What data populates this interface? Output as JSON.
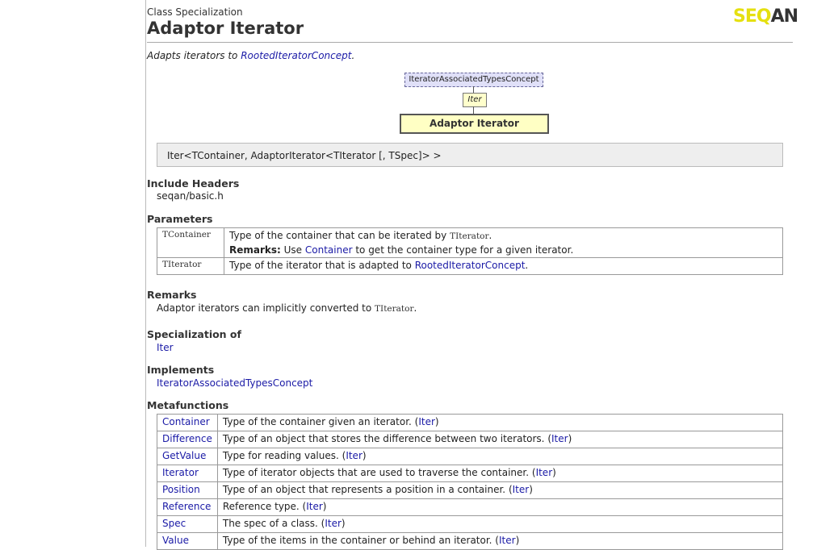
{
  "header": {
    "kind": "Class Specialization",
    "title": "Adaptor Iterator",
    "logo": "SEQAN"
  },
  "summary": {
    "prefix": "Adapts iterators to ",
    "link": "RootedIteratorConcept",
    "suffix": "."
  },
  "diagram": {
    "concept": "IteratorAssociatedTypesConcept",
    "parent": "Iter",
    "self": "Adaptor Iterator"
  },
  "signature": "Iter<TContainer, AdaptorIterator<TIterator [, TSpec]> >",
  "include": {
    "heading": "Include Headers",
    "value": "seqan/basic.h"
  },
  "parameters": {
    "heading": "Parameters",
    "rows": [
      {
        "name": "TContainer",
        "desc": "Type of the container that can be iterated by ",
        "code": "TIterator",
        "end": ".",
        "remarks_label": "Remarks:",
        "remarks_pre": " Use ",
        "remarks_link": "Container",
        "remarks_post": " to get the container type for a given iterator."
      },
      {
        "name": "TIterator",
        "desc": "Type of the iterator that is adapted to ",
        "link": "RootedIteratorConcept",
        "end": "."
      }
    ]
  },
  "remarks": {
    "heading": "Remarks",
    "text": "Adaptor iterators can implicitly converted to ",
    "code": "TIterator",
    "end": "."
  },
  "specialization_of": {
    "heading": "Specialization of",
    "link": "Iter"
  },
  "implements": {
    "heading": "Implements",
    "link": "IteratorAssociatedTypesConcept"
  },
  "metafunctions": {
    "heading": "Metafunctions",
    "rows": [
      {
        "name": "Container",
        "desc": "Type of the container given an iterator. (",
        "ref": "Iter"
      },
      {
        "name": "Difference",
        "desc": "Type of an object that stores the difference between two iterators. (",
        "ref": "Iter"
      },
      {
        "name": "GetValue",
        "desc": "Type for reading values. (",
        "ref": "Iter"
      },
      {
        "name": "Iterator",
        "desc": "Type of iterator objects that are used to traverse the container. (",
        "ref": "Iter"
      },
      {
        "name": "Position",
        "desc": "Type of an object that represents a position in a container. (",
        "ref": "Iter"
      },
      {
        "name": "Reference",
        "desc": "Reference type. (",
        "ref": "Iter"
      },
      {
        "name": "Spec",
        "desc": "The spec of a class. (",
        "ref": "Iter"
      },
      {
        "name": "Value",
        "desc": "Type of the items in the container or behind an iterator. (",
        "ref": "Iter"
      }
    ]
  }
}
